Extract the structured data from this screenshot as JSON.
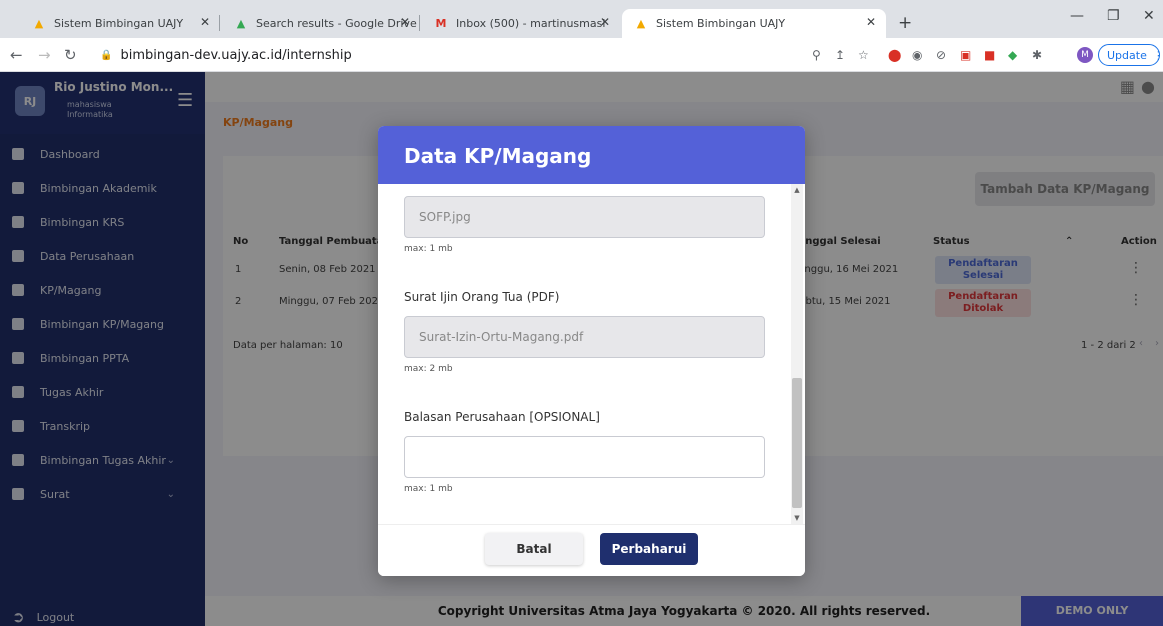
{
  "browser": {
    "tabs": [
      {
        "title": "Sistem Bimbingan UAJY",
        "icon": "uajy-icon"
      },
      {
        "title": "Search results - Google Drive",
        "icon": "google-drive-icon"
      },
      {
        "title": "Inbox (500) - martinusmaslim122",
        "icon": "gmail-icon"
      },
      {
        "title": "Sistem Bimbingan UAJY",
        "icon": "uajy-icon"
      }
    ],
    "url": "bimbingan-dev.uajy.ac.id/internship",
    "update_label": "Update",
    "profile_initial": "M"
  },
  "sidebar": {
    "initials": "RJ",
    "name": "Rio Justino Mon...",
    "role": "mahasiswa",
    "program": "Informatika",
    "items": [
      {
        "label": "Dashboard"
      },
      {
        "label": "Bimbingan Akademik"
      },
      {
        "label": "Bimbingan KRS"
      },
      {
        "label": "Data Perusahaan"
      },
      {
        "label": "KP/Magang"
      },
      {
        "label": "Bimbingan KP/Magang"
      },
      {
        "label": "Bimbingan PPTA"
      },
      {
        "label": "Tugas Akhir"
      },
      {
        "label": "Transkrip"
      },
      {
        "label": "Bimbingan Tugas Akhir"
      },
      {
        "label": "Surat"
      }
    ],
    "logout": "Logout"
  },
  "page": {
    "breadcrumb": "KP/Magang",
    "add_button": "Tambah Data KP/Magang",
    "columns": {
      "no": "No",
      "created": "Tanggal Pembuatan",
      "end": "Tanggal Selesai",
      "status": "Status",
      "action": "Action"
    },
    "rows": [
      {
        "no": "1",
        "created": "Senin, 08 Feb 2021 |",
        "end": "Minggu, 16 Mei 2021",
        "status": "Pendaftaran Selesai"
      },
      {
        "no": "2",
        "created": "Minggu, 07 Feb 202",
        "end": "Sabtu, 15 Mei 2021",
        "status": "Pendaftaran Ditolak"
      }
    ],
    "per_page_label": "Data per halaman:",
    "per_page_value": "10",
    "pagination": "1 - 2 dari 2",
    "footer": "Copyright Universitas Atma Jaya Yogyakarta © 2020. All rights reserved.",
    "demo": "DEMO ONLY",
    "colors": {
      "primary": "#5461d8",
      "sidebar": "#22306c",
      "accent": "#f07c1e"
    }
  },
  "modal": {
    "title": "Data KP/Magang",
    "fields": [
      {
        "label": "",
        "value": "SOFP.jpg",
        "hint": "max: 1 mb"
      },
      {
        "label": "Surat Ijin Orang Tua (PDF)",
        "value": "Surat-Izin-Ortu-Magang.pdf",
        "hint": "max: 2 mb"
      },
      {
        "label": "Balasan Perusahaan [OPSIONAL]",
        "value": "",
        "hint": "max: 1 mb"
      }
    ],
    "cancel": "Batal",
    "submit": "Perbaharui"
  }
}
